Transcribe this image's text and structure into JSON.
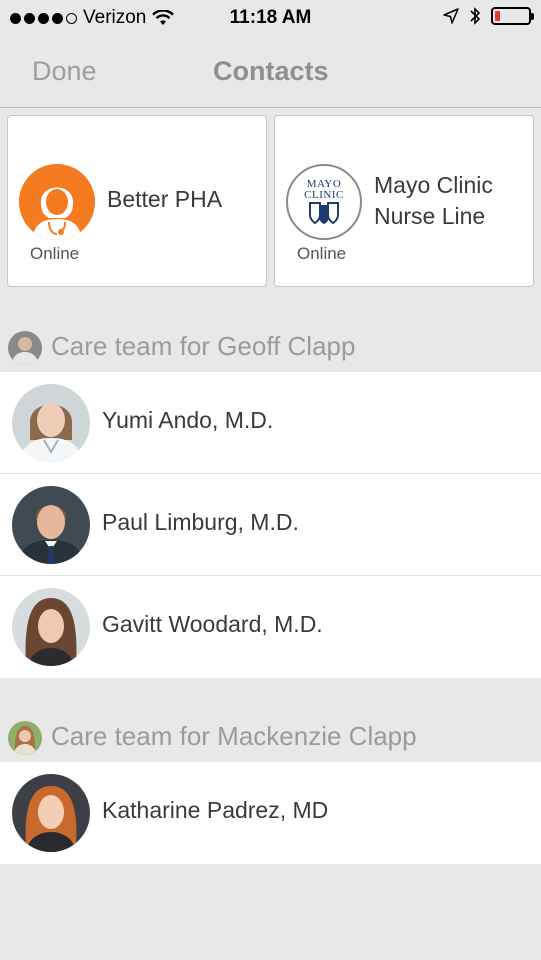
{
  "status_bar": {
    "carrier": "Verizon",
    "time": "11:18 AM",
    "signal_bars_filled": 4,
    "signal_bars_total": 5,
    "battery_level": 0.15,
    "battery_color": "#e23b2e"
  },
  "navbar": {
    "done_label": "Done",
    "title": "Contacts"
  },
  "service_cards": [
    {
      "name": "Better PHA",
      "status": "Online",
      "icon": "nurse-avatar-icon",
      "color": "#f47b20"
    },
    {
      "name_line1": "Mayo Clinic",
      "name_line2": "Nurse Line",
      "status": "Online",
      "logo_text_line1": "MAYO",
      "logo_text_line2": "CLINIC",
      "icon": "mayo-clinic-logo",
      "color": "#1f3a6e"
    }
  ],
  "care_teams": [
    {
      "title": "Care team for Geoff Clapp",
      "members": [
        {
          "name": "Yumi Ando, M.D."
        },
        {
          "name": "Paul Limburg, M.D."
        },
        {
          "name": "Gavitt Woodard, M.D."
        }
      ]
    },
    {
      "title": "Care team for Mackenzie Clapp",
      "members": [
        {
          "name": "Katharine Padrez, MD"
        }
      ]
    }
  ]
}
